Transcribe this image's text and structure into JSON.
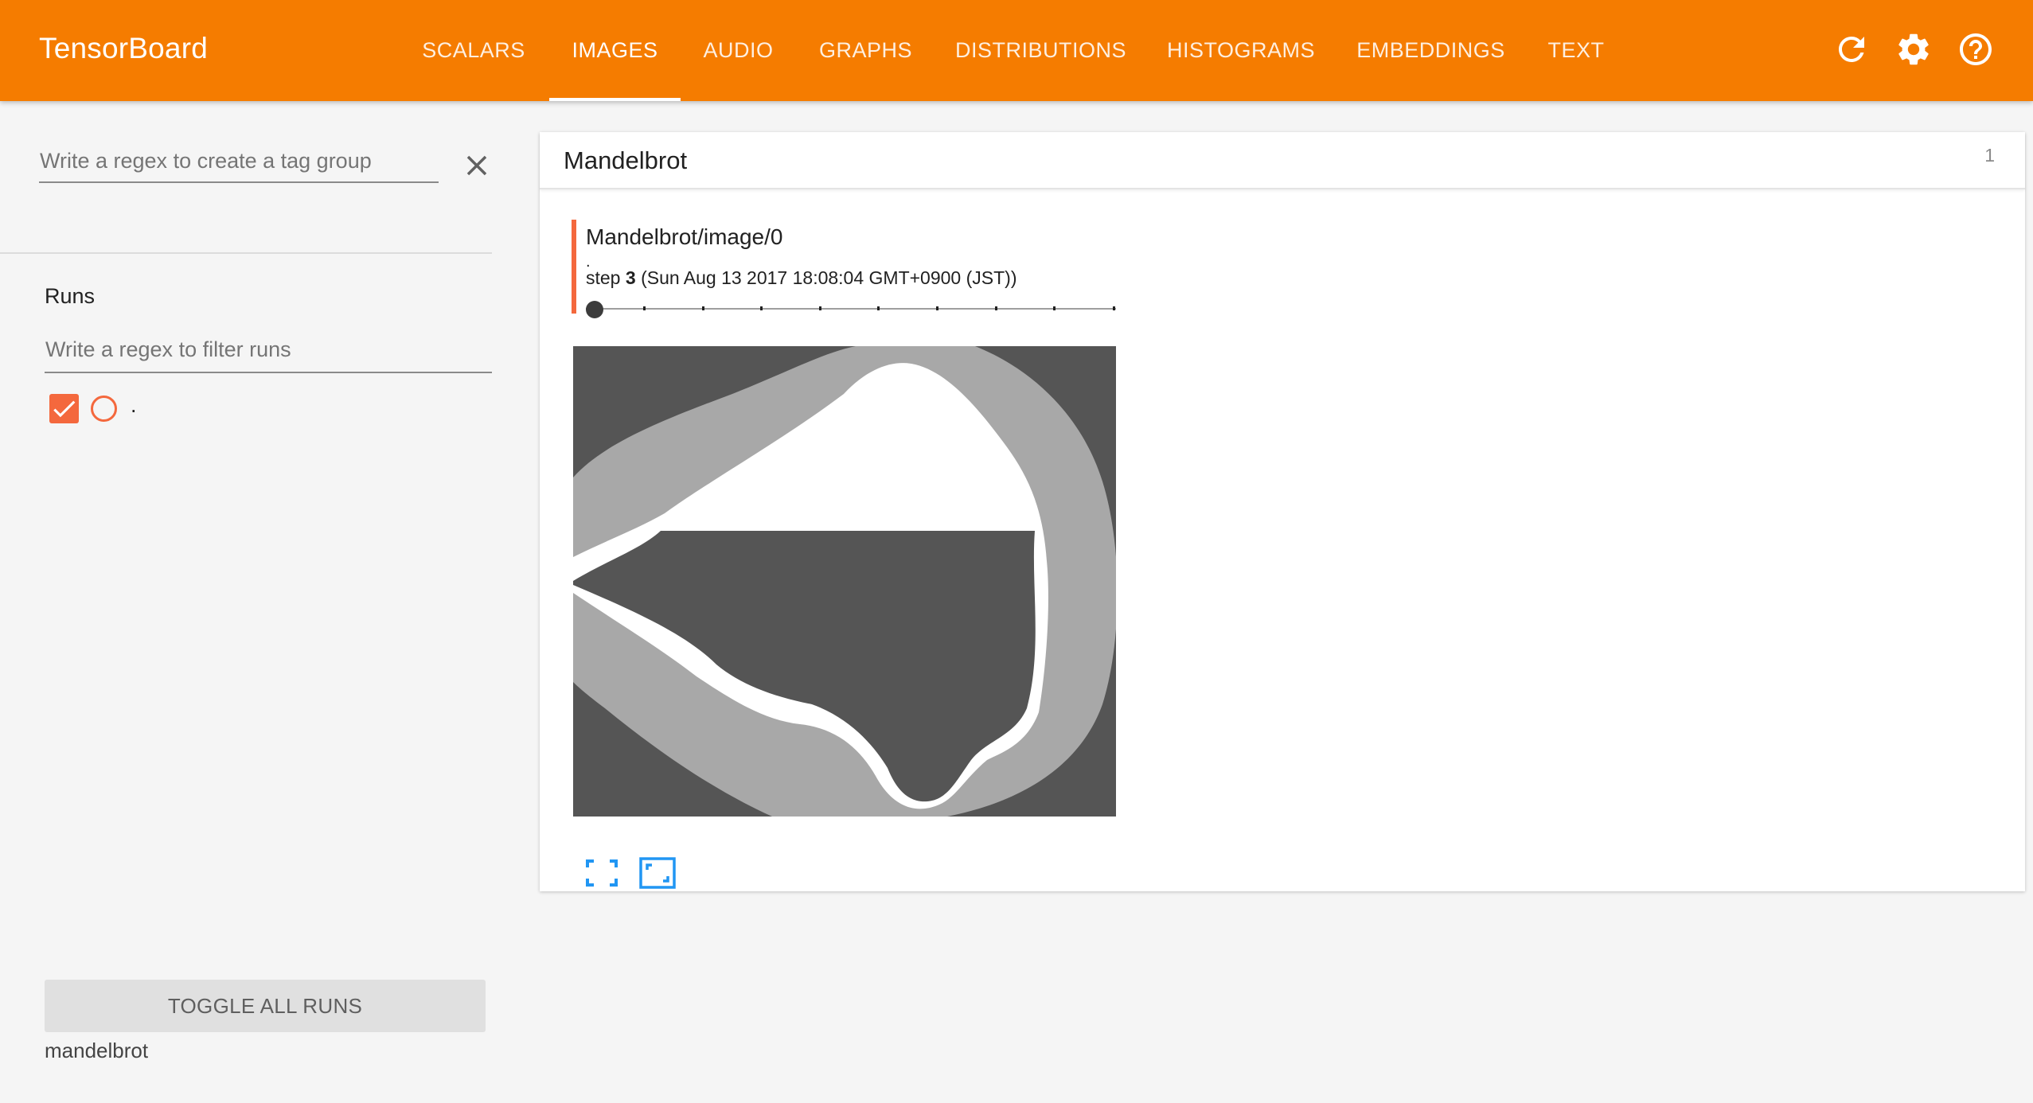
{
  "app": {
    "title": "TensorBoard"
  },
  "colors": {
    "toolbar": "#f57c00",
    "run_accent": "#f4683d",
    "action_icon": "#2196f3",
    "image_dark": "#555555",
    "image_mid": "#a8a8a8",
    "image_light": "#ffffff"
  },
  "nav": {
    "tabs": [
      {
        "label": "SCALARS",
        "active": false
      },
      {
        "label": "IMAGES",
        "active": true
      },
      {
        "label": "AUDIO",
        "active": false
      },
      {
        "label": "GRAPHS",
        "active": false
      },
      {
        "label": "DISTRIBUTIONS",
        "active": false
      },
      {
        "label": "HISTOGRAMS",
        "active": false
      },
      {
        "label": "EMBEDDINGS",
        "active": false
      },
      {
        "label": "TEXT",
        "active": false
      }
    ],
    "icons": [
      "refresh-icon",
      "settings-gear-icon",
      "help-icon"
    ]
  },
  "sidebar": {
    "tag_group_placeholder": "Write a regex to create a tag group",
    "runs_title": "Runs",
    "runs_filter_placeholder": "Write a regex to filter runs",
    "runs": [
      {
        "name": ".",
        "checked": true
      }
    ],
    "toggle_all_label": "TOGGLE ALL RUNS",
    "data_location": "mandelbrot"
  },
  "main": {
    "card": {
      "title": "Mandelbrot",
      "count": "1",
      "image": {
        "tag": "Mandelbrot/image/0",
        "run": ".",
        "step_prefix": "step",
        "step": "3",
        "timestamp": "(Sun Aug 13 2017 18:08:04 GMT+0900 (JST))",
        "slider_value": 0,
        "actions": [
          "fullscreen-icon",
          "actual-size-icon"
        ]
      }
    }
  }
}
